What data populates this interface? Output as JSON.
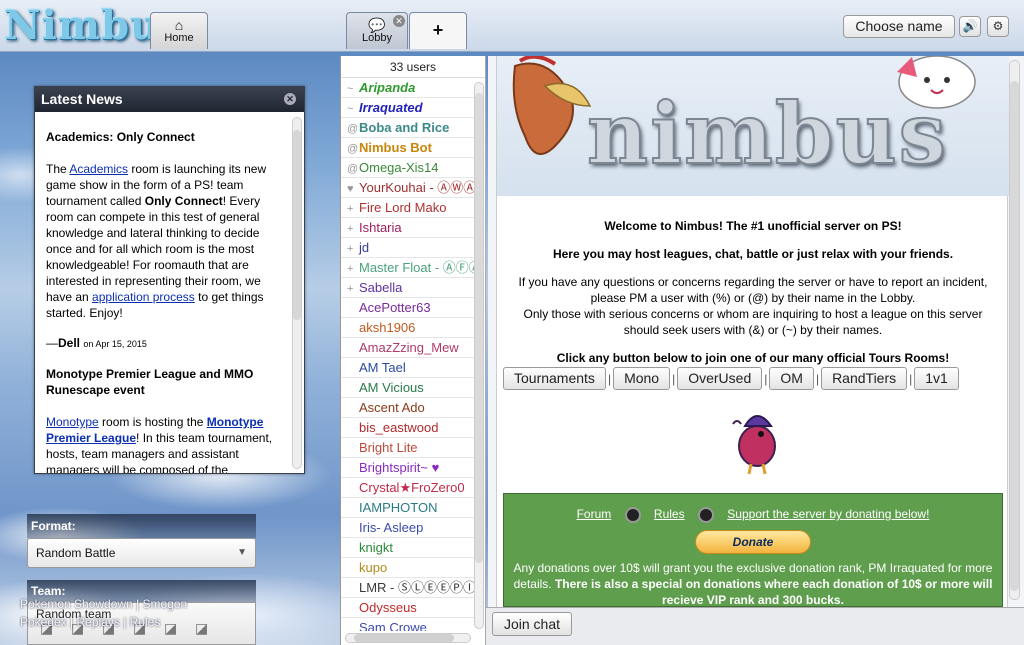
{
  "header": {
    "logo": "Nimbus",
    "tabs": [
      {
        "label": "Home",
        "icon": "home-icon"
      },
      {
        "label": "Lobby",
        "icon": "chat-bubble-icon"
      },
      {
        "label": "+",
        "icon": "plus-icon"
      }
    ],
    "choose_name": "Choose name",
    "sound_icon": "speaker-icon",
    "settings_icon": "gear-icon"
  },
  "news": {
    "title": "Latest News",
    "items": [
      {
        "heading": "Academics: Only Connect",
        "p1_pre": "The ",
        "p1_link": "Academics",
        "p1_mid": " room is launching its new game show in the form of a PS! team tournament called ",
        "p1_bold": "Only Connect",
        "p1_post": "! Every room can compete in this test of general knowledge and lateral thinking to decide once and for all which room is the most knowledgeable! For roomauth that are interested in representing their room, we have an ",
        "p1_link2": "application process",
        "p1_end": " to get things started. Enjoy!",
        "author": "Dell",
        "date": "on Apr 15, 2015"
      },
      {
        "heading": "Monotype Premier League and MMO Runescape event",
        "p1_link": "Monotype",
        "p1_mid": " room is hosting the ",
        "p1_link2": "Monotype Premier League",
        "p1_post": "! In this team tournament, hosts, team managers and assistant managers will be composed of the"
      }
    ]
  },
  "format": {
    "label": "Format:",
    "value": "Random Battle"
  },
  "team": {
    "label": "Team:",
    "value": "Random team"
  },
  "footer": {
    "line1": [
      "Pokemon Showdown",
      "Smogon"
    ],
    "line2": [
      "Pokedex",
      "Replays",
      "Rules"
    ]
  },
  "userlist": {
    "count": "33 users",
    "users": [
      {
        "group": "~",
        "name": "Aripanda",
        "color": "#2f9a2f",
        "style": "bi"
      },
      {
        "group": "~",
        "name": "Irraquated",
        "color": "#2222bb",
        "style": "bi"
      },
      {
        "group": "@",
        "name": "Boba and Rice",
        "color": "#3a8a8a",
        "style": "b"
      },
      {
        "group": "@",
        "name": "Nimbus Bot",
        "color": "#c8860a",
        "style": "b"
      },
      {
        "group": "@",
        "name": "Omega-Xis14",
        "color": "#3a8a3a",
        "style": ""
      },
      {
        "group": "♥",
        "name": "YourKouhai - ⒶⓌⒶ",
        "color": "#a03030",
        "style": ""
      },
      {
        "group": "+",
        "name": "Fire Lord Mako",
        "color": "#b03030",
        "style": ""
      },
      {
        "group": "+",
        "name": "Ishtaria",
        "color": "#a02060",
        "style": ""
      },
      {
        "group": "+",
        "name": "jd",
        "color": "#3a3aa8",
        "style": ""
      },
      {
        "group": "+",
        "name": "Master Float - ⒶⒻⒶ",
        "color": "#4aa07a",
        "style": ""
      },
      {
        "group": "+",
        "name": "Sabella",
        "color": "#6030a0",
        "style": ""
      },
      {
        "group": "",
        "name": "AcePotter63",
        "color": "#7a2a9a",
        "style": ""
      },
      {
        "group": "",
        "name": "aksh1906",
        "color": "#c05a20",
        "style": ""
      },
      {
        "group": "",
        "name": "AmazZzing_Mew",
        "color": "#b03a6a",
        "style": ""
      },
      {
        "group": "",
        "name": "AM Tael",
        "color": "#2a4aa0",
        "style": ""
      },
      {
        "group": "",
        "name": "AM Vicious",
        "color": "#2a7a4a",
        "style": ""
      },
      {
        "group": "",
        "name": "Ascent Ado",
        "color": "#8a3a1a",
        "style": ""
      },
      {
        "group": "",
        "name": "bis_eastwood",
        "color": "#b02a2a",
        "style": ""
      },
      {
        "group": "",
        "name": "Bright Lite",
        "color": "#c04a3a",
        "style": ""
      },
      {
        "group": "",
        "name": "Brightspirit~ ♥",
        "color": "#8a2ac0",
        "style": ""
      },
      {
        "group": "",
        "name": "Crystal★FroZero0",
        "color": "#c02a4a",
        "style": ""
      },
      {
        "group": "",
        "name": "IAMPHOTON",
        "color": "#2a7a8a",
        "style": ""
      },
      {
        "group": "",
        "name": "Iris- Asleep",
        "color": "#3a4ab0",
        "style": ""
      },
      {
        "group": "",
        "name": "knigkt",
        "color": "#2a8a3a",
        "style": ""
      },
      {
        "group": "",
        "name": "kupo",
        "color": "#b08a1a",
        "style": ""
      },
      {
        "group": "",
        "name": "LMR - ⓈⓁⒺⒺⓅⒾⓃ",
        "color": "#3a3a3a",
        "style": ""
      },
      {
        "group": "",
        "name": "Odysseus",
        "color": "#c02a2a",
        "style": ""
      },
      {
        "group": "",
        "name": "Sam Crowe",
        "color": "#3a4ab0",
        "style": ""
      }
    ]
  },
  "room": {
    "banner_text": "nimbus",
    "welcome_1": "Welcome to Nimbus! The #1 unofficial server on PS!",
    "welcome_2": "Here you may host leagues, chat, battle or just relax with your friends.",
    "welcome_3a": "If you have any questions or concerns regarding the server or have to report an incident, please PM a user with (%) or (@) by their name in the Lobby.",
    "welcome_3b": "Only those with serious concerns or whom are inquiring to host a league on this server should seek users with (&) or (~) by their names.",
    "welcome_4": "Click any button below to join one of our many official Tours Rooms!",
    "tour_buttons": [
      "Tournaments",
      "Mono",
      "OverUsed",
      "OM",
      "RandTiers",
      "1v1"
    ],
    "donate": {
      "forum": "Forum",
      "rules": "Rules",
      "support": "Support the server by donating below!",
      "button": "Donate",
      "text_normal": "Any donations over 10$ will grant you the exclusive donation rank, PM Irraquated for more details. ",
      "text_bold": "There is also a special on donations where each donation of 10$ or more will recieve VIP rank and 300 bucks."
    }
  },
  "chatbar": {
    "join": "Join chat"
  }
}
